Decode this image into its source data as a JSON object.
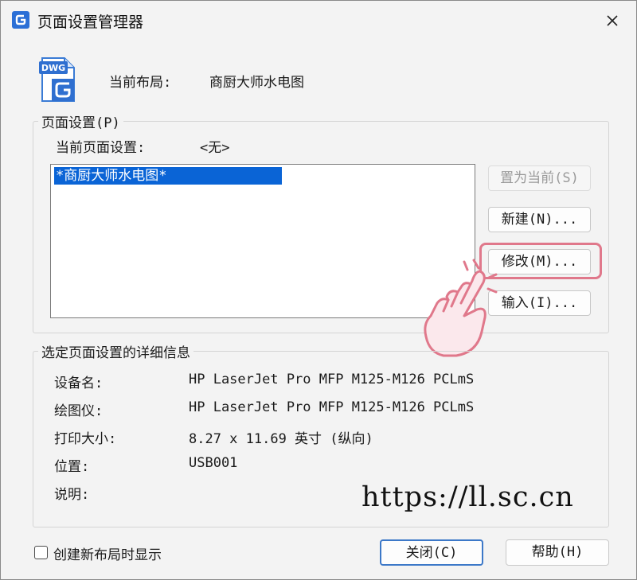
{
  "window": {
    "title": "页面设置管理器"
  },
  "layout": {
    "label": "当前布局:",
    "value": "商厨大师水电图"
  },
  "file_icon": {
    "text": "DWG"
  },
  "page_setup": {
    "legend": "页面设置(P)",
    "current_label": "当前页面设置:",
    "current_value": "<无>",
    "items": [
      "*商厨大师水电图*"
    ],
    "buttons": {
      "set_current": "置为当前(S)",
      "new": "新建(N)...",
      "modify": "修改(M)...",
      "import": "输入(I)..."
    }
  },
  "details": {
    "legend": "选定页面设置的详细信息",
    "rows": [
      {
        "label": "设备名:",
        "value": "HP LaserJet Pro MFP M125-M126 PCLmS"
      },
      {
        "label": "绘图仪:",
        "value": "HP LaserJet Pro MFP M125-M126 PCLmS"
      },
      {
        "label": "打印大小:",
        "value": "8.27 x 11.69 英寸 (纵向)"
      },
      {
        "label": "位置:",
        "value": "USB001"
      },
      {
        "label": "说明:",
        "value": ""
      }
    ]
  },
  "footer": {
    "checkbox_label": "创建新布局时显示",
    "checkbox_checked": false,
    "close_label": "关闭(C)",
    "help_label": "帮助(H)"
  },
  "watermark": "https://ll.sc.cn",
  "colors": {
    "accent": "#0a64d6",
    "highlight": "#e0788b",
    "app_icon": "#2b6fd6"
  }
}
